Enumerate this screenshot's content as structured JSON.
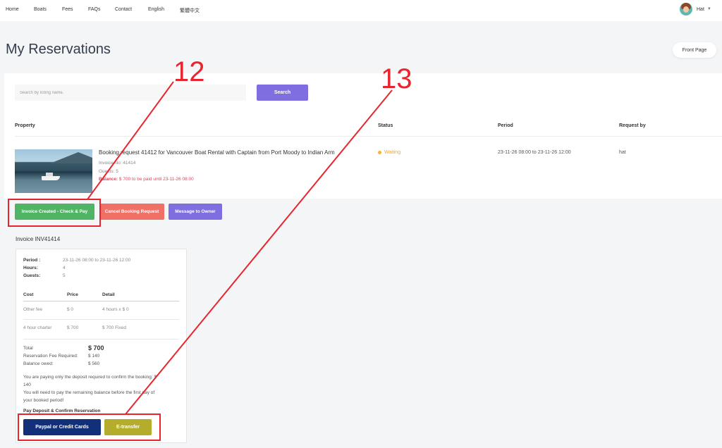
{
  "nav": {
    "items": [
      "Home",
      "Boats",
      "Fees",
      "FAQs",
      "Contact",
      "English",
      "繁體中文"
    ],
    "user_name": "Hat"
  },
  "header": {
    "title": "My Reservations",
    "front_page_label": "Front Page"
  },
  "search": {
    "placeholder": "Search by listing name.",
    "button_label": "Search"
  },
  "table": {
    "headers": [
      "Property",
      "Status",
      "Period",
      "Request by"
    ]
  },
  "reservation": {
    "title": "Booking request 41412 for Vancouver Boat Rental with Captain from Port Moody to Indian Arm",
    "invoice_no": "Invoice No: 41414",
    "guests": "Guests: 5",
    "balance_label": "Balance:",
    "balance_text": "$ 700 to be paid until 23-11-26 08:00",
    "status": "Waiting",
    "period": "23-11-26 08:00 to 23-11-26 12:00",
    "request_by": "hat"
  },
  "actions": {
    "invoice_label": "Invoice Created - Check & Pay",
    "cancel_label": "Cancel Booking Request",
    "message_label": "Message to Owner"
  },
  "invoice": {
    "title": "Invoice INV41414",
    "period_label": "Period :",
    "period_value": "23-11-26 08:00 to 23-11-26 12:00",
    "hours_label": "Hours:",
    "hours_value": "4",
    "guests_label": "Guests:",
    "guests_value": "5",
    "columns": [
      "Cost",
      "Price",
      "Detail"
    ],
    "rows": [
      {
        "cost": "Other fee",
        "price": "$ 0",
        "detail": "4 hours x $ 0"
      },
      {
        "cost": "4 hour charter",
        "price": "$ 700",
        "detail": "$ 700 Fixed"
      }
    ],
    "total_label": "Total",
    "total_value": "$ 700",
    "fee_label": "Reservation Fee Required:",
    "fee_value": "$ 140",
    "owed_label": "Balance owed:",
    "owed_value": "$ 560",
    "note_lines": [
      "You are paying only the deposit required to confirm the booking: $",
      "140",
      "You will need to pay the remaining balance before the first day of",
      "your booked period!"
    ],
    "pay_title": "Pay Deposit & Confirm Reservation",
    "paypal_label": "Paypal or Credit Cards",
    "etransfer_label": "E-transfer"
  },
  "annotations": {
    "label_12": "12",
    "label_13": "13",
    "color": "#e8252f"
  }
}
